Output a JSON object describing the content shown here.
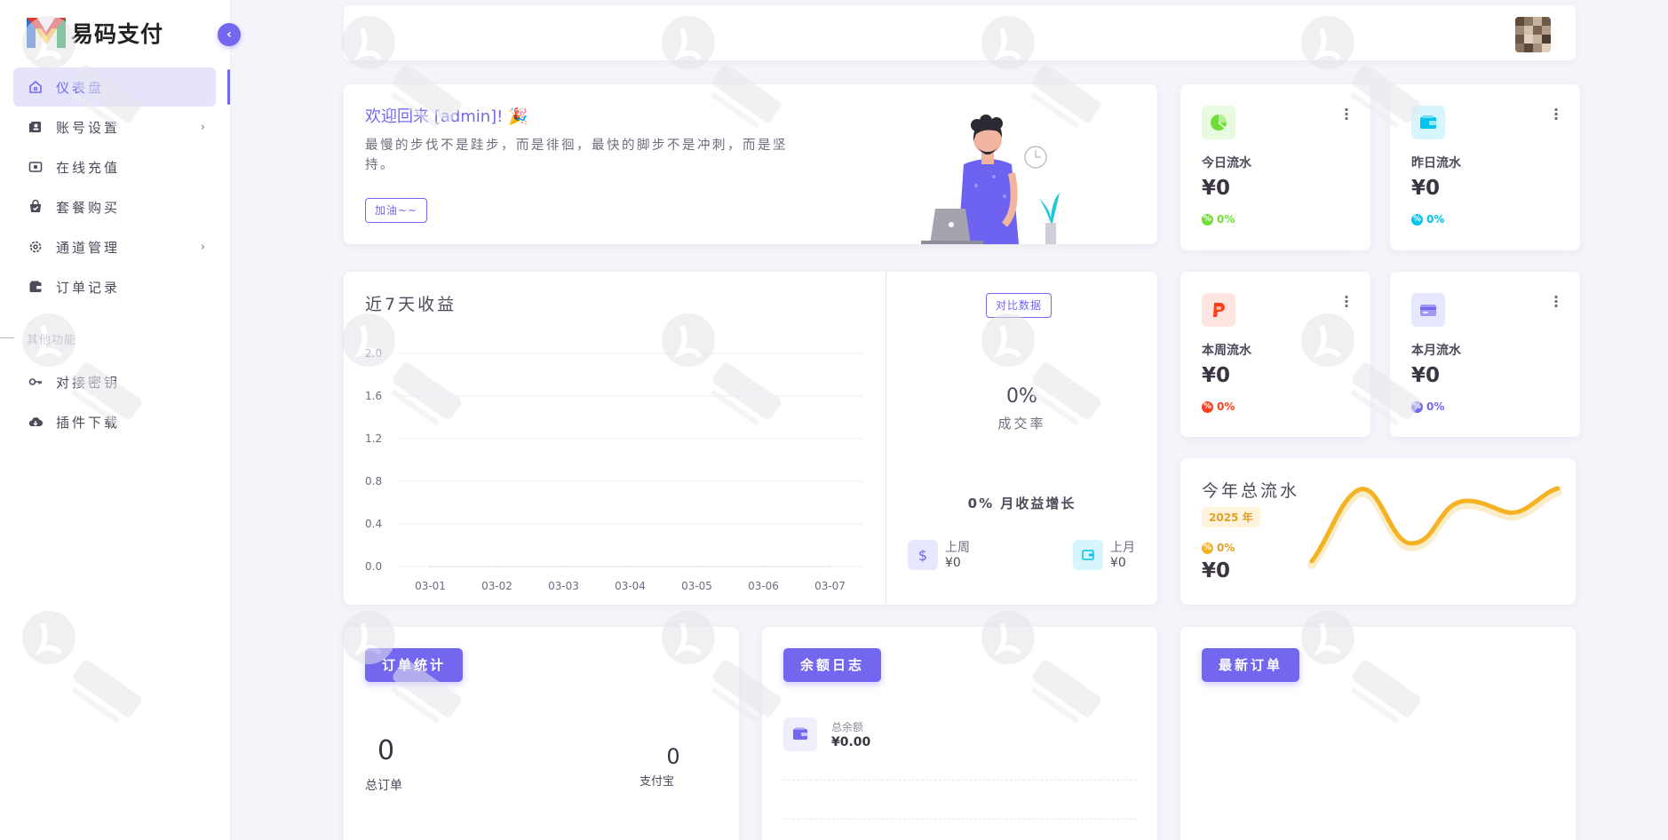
{
  "brand": {
    "name": "易码支付"
  },
  "sidebar": {
    "items": [
      {
        "label": "仪表盘",
        "icon": "home-icon",
        "active": true
      },
      {
        "label": "账号设置",
        "icon": "account-icon",
        "has_children": true
      },
      {
        "label": "在线充值",
        "icon": "recharge-icon"
      },
      {
        "label": "套餐购买",
        "icon": "shopping-bag-icon"
      },
      {
        "label": "通道管理",
        "icon": "gear-icon",
        "has_children": true
      },
      {
        "label": "订单记录",
        "icon": "wallet-icon"
      }
    ],
    "section_label": "其他功能",
    "items2": [
      {
        "label": "对接密钥",
        "icon": "key-icon"
      },
      {
        "label": "插件下载",
        "icon": "cloud-download-icon"
      }
    ]
  },
  "welcome": {
    "title": "欢迎回来 [admin]! 🎉",
    "text": "最慢的步伐不是跬步，而是徘徊，最快的脚步不是冲刺，而是坚持。",
    "button": "加油~~"
  },
  "stats": [
    {
      "label": "今日流水",
      "value": "¥0",
      "pct": "0%",
      "color": "#71dd37",
      "bg": "#e8fadf",
      "icon": "pie-chart-icon"
    },
    {
      "label": "昨日流水",
      "value": "¥0",
      "pct": "0%",
      "color": "#03c3ec",
      "bg": "#d7f5fc",
      "icon": "wallet-icon"
    },
    {
      "label": "本周流水",
      "value": "¥0",
      "pct": "0%",
      "color": "#ff3e1d",
      "bg": "#ffe5e0",
      "icon": "paypal-icon"
    },
    {
      "label": "本月流水",
      "value": "¥0",
      "pct": "0%",
      "color": "#7367f0",
      "bg": "#e7e7ff",
      "icon": "credit-card-icon"
    }
  ],
  "year": {
    "title": "今年总流水",
    "badge": "2025 年",
    "pct": "0%",
    "value": "¥0",
    "color": "#f5b324"
  },
  "income_chart": {
    "title": "近7天收益",
    "compare_button": "对比数据",
    "rate_value": "0%",
    "rate_label": "成交率",
    "growth": "0% 月收益增长",
    "last_week_label": "上周",
    "last_week_value": "¥0",
    "last_month_label": "上月",
    "last_month_value": "¥0"
  },
  "chart_data": {
    "type": "line",
    "title": "近7天收益",
    "categories": [
      "03-01",
      "03-02",
      "03-03",
      "03-04",
      "03-05",
      "03-06",
      "03-07"
    ],
    "values": [
      0,
      0,
      0,
      0,
      0,
      0,
      0
    ],
    "y_ticks": [
      "0.0",
      "0.4",
      "0.8",
      "1.2",
      "1.6",
      "2.0"
    ],
    "ylim": [
      0,
      2.0
    ],
    "grid": true
  },
  "orders": {
    "button": "订单统计",
    "total_value": "0",
    "total_label": "总订单",
    "alipay_value": "0",
    "alipay_label": "支付宝"
  },
  "balance": {
    "button": "余额日志",
    "label": "总余额",
    "value": "¥0.00"
  },
  "latest": {
    "button": "最新订单"
  },
  "colors": {
    "accent": "#7367f0",
    "background": "#f4f5fa"
  }
}
